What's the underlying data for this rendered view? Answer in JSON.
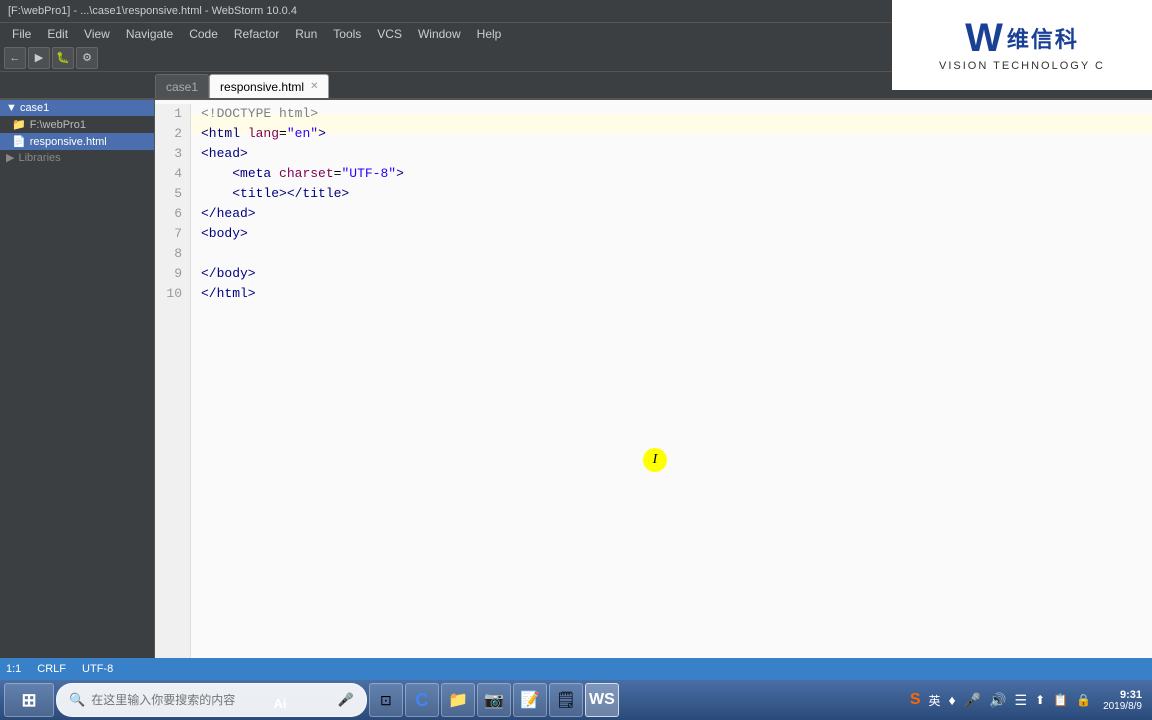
{
  "title_bar": {
    "text": "[F:\\webPro1] - ...\\case1\\responsive.html - WebStorm 10.0.4"
  },
  "menu": {
    "items": [
      "File",
      "Edit",
      "View",
      "Navigate",
      "Code",
      "Refactor",
      "Run",
      "Tools",
      "VCS",
      "Window",
      "Help"
    ]
  },
  "tabs": [
    {
      "label": "case1",
      "active": false,
      "closeable": false
    },
    {
      "label": "responsive.html",
      "active": true,
      "closeable": true
    }
  ],
  "sidebar": {
    "project_label": "case1",
    "items": [
      {
        "label": "F:\\webPro1",
        "type": "folder",
        "indent": 0
      },
      {
        "label": "responsive.html",
        "type": "file",
        "active": true,
        "indent": 1
      },
      {
        "label": "Libraries",
        "type": "section",
        "indent": 0
      }
    ]
  },
  "editor": {
    "lines": [
      {
        "num": 1,
        "code": "<!DOCTYPE html>"
      },
      {
        "num": 2,
        "code": "<html lang=\"en\">"
      },
      {
        "num": 3,
        "code": "<head>"
      },
      {
        "num": 4,
        "code": "    <meta charset=\"UTF-8\">"
      },
      {
        "num": 5,
        "code": "    <title></title>"
      },
      {
        "num": 6,
        "code": "</head>"
      },
      {
        "num": 7,
        "code": "<body>"
      },
      {
        "num": 8,
        "code": ""
      },
      {
        "num": 9,
        "code": "</body>"
      },
      {
        "num": 10,
        "code": "</html>"
      }
    ]
  },
  "cursor": {
    "symbol": "I"
  },
  "status_bar": {
    "position": "1:1",
    "encoding": "UTF-8",
    "line_sep": "CRLF",
    "indent": "4"
  },
  "logo": {
    "chinese": "维信科",
    "english": "VISION TECHNOLOGY C"
  },
  "taskbar": {
    "start_label": "⊞",
    "search_placeholder": "在这里输入你要搜索的内容",
    "apps": [
      {
        "icon": "⊞",
        "name": "start-button"
      },
      {
        "icon": "⬛",
        "name": "task-view"
      },
      {
        "icon": "🌐",
        "name": "chrome-icon"
      },
      {
        "icon": "📁",
        "name": "file-explorer-icon"
      },
      {
        "icon": "📷",
        "name": "camera-icon"
      },
      {
        "icon": "📝",
        "name": "notes-icon"
      },
      {
        "icon": "🗒",
        "name": "notepad-icon"
      },
      {
        "icon": "W",
        "name": "webstorm-icon"
      }
    ],
    "tray": {
      "icons": [
        "S",
        "英",
        "♦",
        "🎤",
        "🔊",
        "☰",
        "⬆",
        "📋",
        "🔒"
      ],
      "ime": "英",
      "time": "9:31",
      "date": "2019/8/9"
    }
  },
  "ai_label": "Ai"
}
